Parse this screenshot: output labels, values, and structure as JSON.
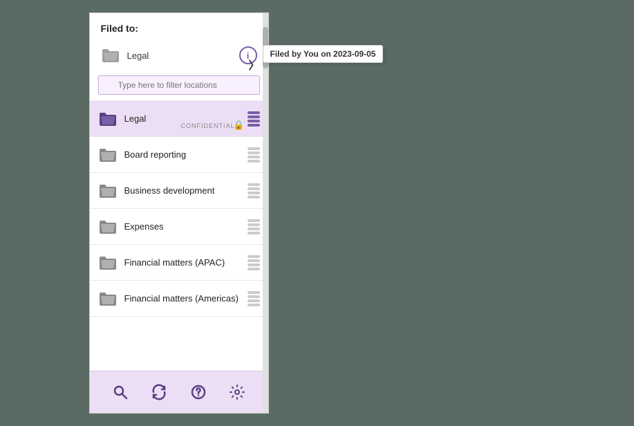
{
  "header": {
    "filed_to_label": "Filed to:"
  },
  "filed_item": {
    "label": "Legal",
    "info_tooltip": "Filed by You on 2023-09-05"
  },
  "filter": {
    "placeholder": "Type here to filter locations"
  },
  "locations": [
    {
      "id": "legal",
      "label": "Legal",
      "selected": true,
      "confidential": true
    },
    {
      "id": "board-reporting",
      "label": "Board reporting",
      "selected": false,
      "confidential": false
    },
    {
      "id": "business-development",
      "label": "Business development",
      "selected": false,
      "confidential": false
    },
    {
      "id": "expenses",
      "label": "Expenses",
      "selected": false,
      "confidential": false
    },
    {
      "id": "financial-matters-apac",
      "label": "Financial matters (APAC)",
      "selected": false,
      "confidential": false
    },
    {
      "id": "financial-matters-americas",
      "label": "Financial matters (Americas)",
      "selected": false,
      "confidential": false
    }
  ],
  "toolbar": {
    "search_label": "Search",
    "refresh_label": "Refresh",
    "help_label": "Help",
    "settings_label": "Settings"
  }
}
